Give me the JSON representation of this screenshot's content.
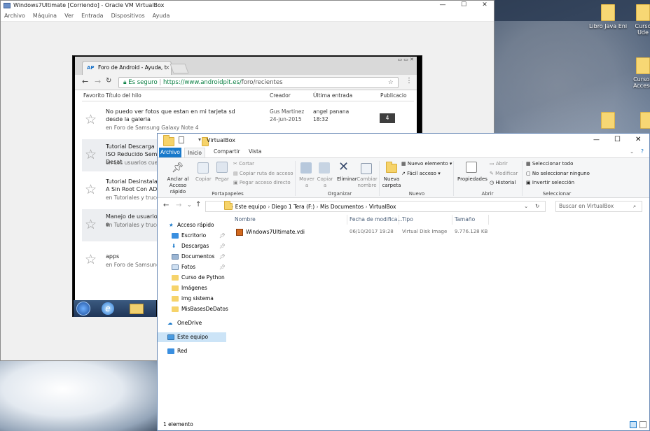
{
  "desktop": {
    "icons": [
      {
        "label": "Libro Java Eni"
      },
      {
        "label": "Curso Ude"
      },
      {
        "label": "CursoP Acceso"
      }
    ]
  },
  "vbox": {
    "title": "Windows7Ultimate [Corriendo] - Oracle VM VirtualBox",
    "menu": [
      "Archivo",
      "Máquina",
      "Ver",
      "Entrada",
      "Dispositivos",
      "Ayuda"
    ],
    "controls": {
      "minimize": "—",
      "maximize": "☐",
      "close": "✕"
    }
  },
  "chrome": {
    "tab_title": "Foro de Android - Ayuda, t",
    "tab_logo": "AP",
    "secure_label": "Es seguro",
    "url_prefix": "https://www.androidpit.es/",
    "url_path": "foro/recientes",
    "columns": {
      "favorito": "Favorito",
      "titulo": "Título del hilo",
      "creador": "Creador",
      "ultima": "Última entrada",
      "publicacion": "Publicacio"
    },
    "threads": [
      {
        "title": "No puedo ver fotos que estan en mi tarjeta sd desde la galeria",
        "forum": "en Foro de Samsung Galaxy Note 4",
        "author": "Gus Martinez",
        "author_date": "24-jun-2015",
        "last_user": "angel panana",
        "last_time": "18:32",
        "count": "4"
      },
      {
        "title": "Tutorial Descarga ISO Reducido Semi-Desat",
        "forum": "en Los usuarios cuent"
      },
      {
        "title": "Tutorial Desinstalar A Sin Root Con ADB",
        "forum": "en Tutoriales y trucos"
      },
      {
        "title": "Manejo de usuarios e",
        "forum": "en Tutoriales y trucos"
      },
      {
        "title": "apps",
        "forum": "en Foro de Samsung"
      }
    ]
  },
  "explorer": {
    "title": "VirtualBox",
    "tabs": [
      "Archivo",
      "Inicio",
      "Compartir",
      "Vista"
    ],
    "ribbon": {
      "portapapeles": {
        "group": "Portapapeles",
        "anclar": "Anclar al Acceso rápido",
        "copiar": "Copiar",
        "pegar": "Pegar",
        "cortar": "Cortar",
        "copiar_ruta": "Copiar ruta de acceso",
        "pegar_acceso": "Pegar acceso directo"
      },
      "organizar": {
        "group": "Organizar",
        "mover": "Mover a",
        "copiar_a": "Copiar a",
        "eliminar": "Eliminar",
        "cambiar": "Cambiar nombre"
      },
      "nuevo": {
        "group": "Nuevo",
        "nueva_carpeta": "Nueva carpeta",
        "nuevo_elemento": "Nuevo elemento",
        "facil_acceso": "Fácil acceso"
      },
      "abrir": {
        "group": "Abrir",
        "propiedades": "Propiedades",
        "abrir": "Abrir",
        "modificar": "Modificar",
        "historial": "Historial"
      },
      "seleccionar": {
        "group": "Seleccionar",
        "todo": "Seleccionar todo",
        "ninguno": "No seleccionar ninguno",
        "invertir": "Invertir selección"
      }
    },
    "path": [
      "Este equipo",
      "Diego 1 Tera (F:)",
      "Mis Documentos",
      "VirtualBox"
    ],
    "search_placeholder": "Buscar en VirtualBox",
    "nav": [
      {
        "label": "Acceso rápido"
      },
      {
        "label": "Escritorio"
      },
      {
        "label": "Descargas"
      },
      {
        "label": "Documentos"
      },
      {
        "label": "Fotos"
      },
      {
        "label": "Curso de Python"
      },
      {
        "label": "Imágenes"
      },
      {
        "label": "img sistema"
      },
      {
        "label": "MisBasesDeDatos"
      },
      {
        "label": "OneDrive"
      },
      {
        "label": "Este equipo"
      },
      {
        "label": "Red"
      }
    ],
    "columns": {
      "nombre": "Nombre",
      "fecha": "Fecha de modifica...",
      "tipo": "Tipo",
      "tamano": "Tamaño"
    },
    "files": [
      {
        "name": "Windows7Ultimate.vdi",
        "date": "06/10/2017 19:28",
        "type": "Virtual Disk Image",
        "size": "9.776.128 KB"
      }
    ],
    "status": "1 elemento",
    "controls": {
      "minimize": "—",
      "maximize": "☐",
      "close": "✕"
    }
  }
}
